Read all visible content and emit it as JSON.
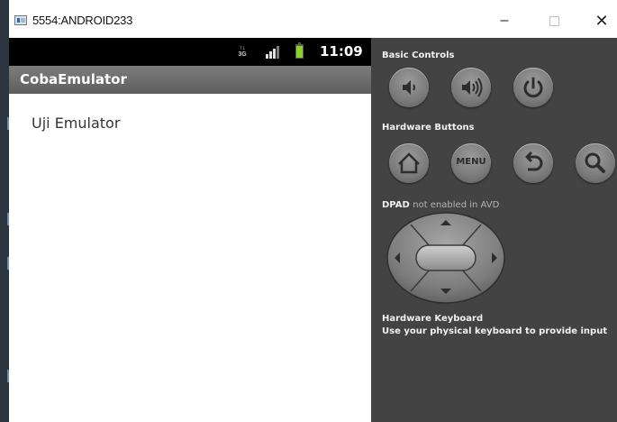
{
  "window": {
    "title": "5554:ANDROID233",
    "minimize_glyph": "–",
    "close_glyph": "✕"
  },
  "statusbar": {
    "data_indicator_top": "↑↓",
    "data_indicator_bottom": "3G",
    "time": "11:09",
    "battery_color": "#8ad12a"
  },
  "app": {
    "name": "CobaEmulator",
    "content_text": "Uji Emulator"
  },
  "panel": {
    "basic_controls_label": "Basic Controls",
    "basic_controls": [
      {
        "name": "volume-down",
        "icon": "volume-down-icon"
      },
      {
        "name": "volume-up",
        "icon": "volume-up-icon"
      },
      {
        "name": "power",
        "icon": "power-icon"
      }
    ],
    "hardware_buttons_label": "Hardware Buttons",
    "hardware_buttons": [
      {
        "name": "home",
        "icon": "home-icon"
      },
      {
        "name": "menu",
        "label": "MENU"
      },
      {
        "name": "back",
        "icon": "back-icon"
      },
      {
        "name": "search",
        "icon": "search-icon"
      }
    ],
    "dpad_label_bold": "DPAD",
    "dpad_label_rest": "not enabled in AVD",
    "keyboard_label": "Hardware Keyboard",
    "keyboard_sub": "Use your physical keyboard to provide input"
  },
  "colors": {
    "panel_bg": "#434343",
    "actionbar": "#6e6e6e",
    "statusbar": "#000000"
  }
}
